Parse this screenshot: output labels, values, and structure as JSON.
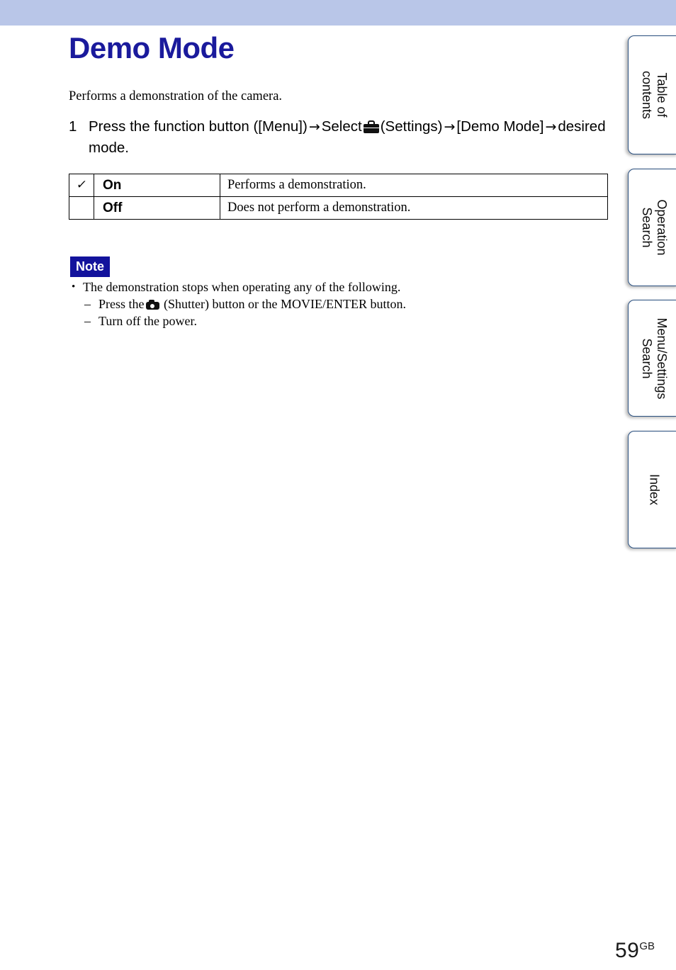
{
  "header": {
    "band_color": "#b9c6e8"
  },
  "page": {
    "title": "Demo Mode",
    "title_color": "#1a1a9c",
    "intro": "Performs a demonstration of the camera.",
    "number": "59",
    "number_suffix": "GB"
  },
  "step": {
    "number": "1",
    "part1": "Press the function button ([Menu])",
    "arrow1": "→",
    "part2": "Select",
    "settings_icon": "settings-toolbox-icon",
    "part3": "(Settings)",
    "arrow2": "→",
    "part4": "[Demo Mode]",
    "arrow3": "→",
    "part5": "desired mode."
  },
  "options_table": {
    "check_glyph": "✓",
    "rows": [
      {
        "checked": true,
        "name": "On",
        "description": "Performs a demonstration."
      },
      {
        "checked": false,
        "name": "Off",
        "description": "Does not perform a demonstration."
      }
    ]
  },
  "note": {
    "badge": "Note",
    "badge_bg": "#12129c",
    "badge_color": "#ffffff",
    "bullet": "The demonstration stops when operating any of the following.",
    "sub1_pre": "Press the",
    "sub1_icon": "camera-shutter-icon",
    "sub1_post": "(Shutter) button or the MOVIE/ENTER button.",
    "sub2": "Turn off the power."
  },
  "side_tabs": [
    {
      "label": "Table of\ncontents",
      "line1": "Table of",
      "line2": "contents"
    },
    {
      "label": "Operation\nSearch",
      "line1": "Operation",
      "line2": "Search"
    },
    {
      "label": "Menu/Settings\nSearch",
      "line1": "Menu/Settings",
      "line2": "Search"
    },
    {
      "label": "Index",
      "line1": "Index",
      "line2": ""
    }
  ]
}
